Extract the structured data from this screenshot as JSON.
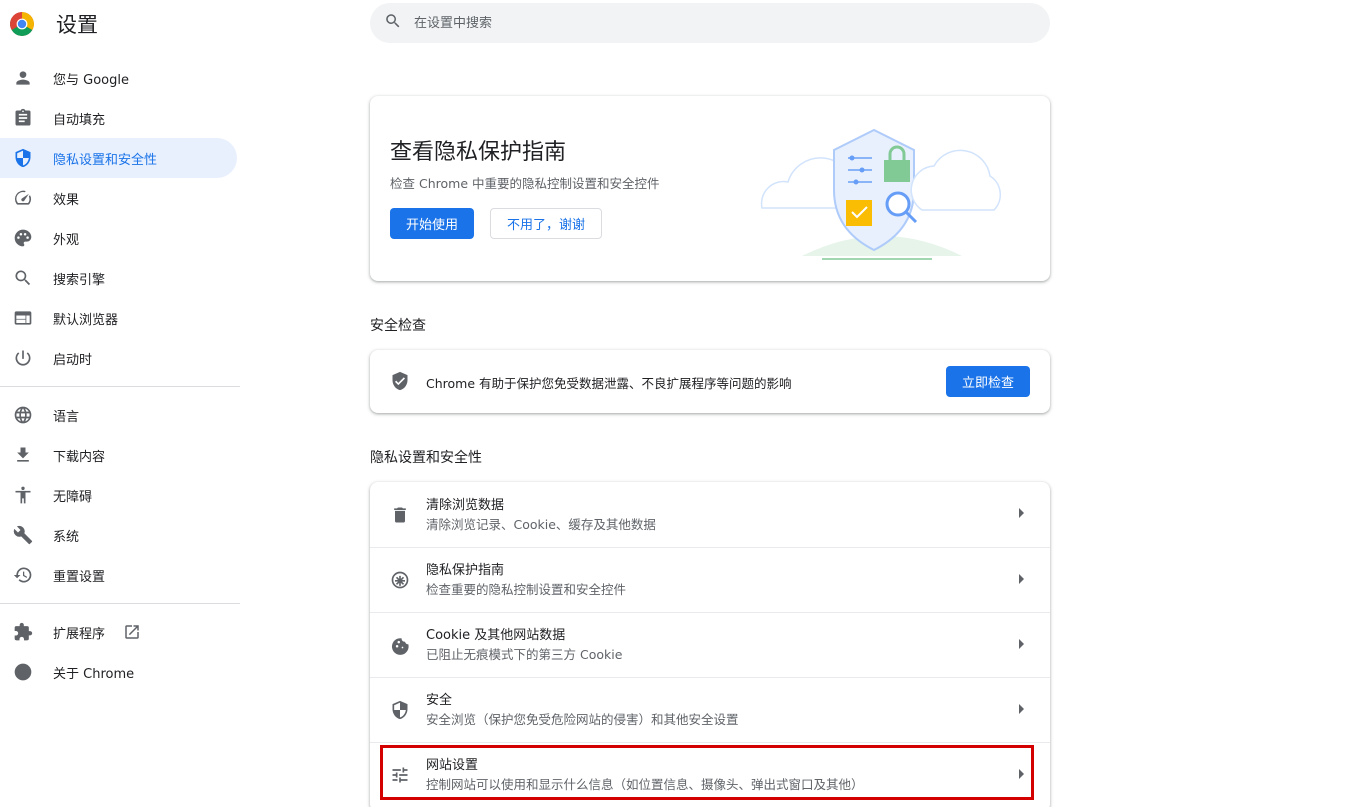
{
  "app": {
    "title": "设置"
  },
  "search": {
    "placeholder": "在设置中搜索"
  },
  "sidebar": {
    "items": [
      {
        "label": "您与 Google",
        "icon": "person-icon"
      },
      {
        "label": "自动填充",
        "icon": "clipboard-icon"
      },
      {
        "label": "隐私设置和安全性",
        "icon": "shield-icon",
        "active": true
      },
      {
        "label": "效果",
        "icon": "speedometer-icon"
      },
      {
        "label": "外观",
        "icon": "palette-icon"
      },
      {
        "label": "搜索引擎",
        "icon": "search-icon"
      },
      {
        "label": "默认浏览器",
        "icon": "browser-icon"
      },
      {
        "label": "启动时",
        "icon": "power-icon"
      }
    ],
    "items2": [
      {
        "label": "语言",
        "icon": "globe-icon"
      },
      {
        "label": "下载内容",
        "icon": "download-icon"
      },
      {
        "label": "无障碍",
        "icon": "accessibility-icon"
      },
      {
        "label": "系统",
        "icon": "wrench-icon"
      },
      {
        "label": "重置设置",
        "icon": "history-icon"
      }
    ],
    "items3": [
      {
        "label": "扩展程序",
        "icon": "puzzle-icon"
      },
      {
        "label": "关于 Chrome",
        "icon": "chrome-icon"
      }
    ]
  },
  "guide": {
    "title": "查看隐私保护指南",
    "description": "检查 Chrome 中重要的隐私控制设置和安全控件",
    "start_label": "开始使用",
    "no_label": "不用了，谢谢"
  },
  "safety": {
    "section_title": "安全检查",
    "text": "Chrome 有助于保护您免受数据泄露、不良扩展程序等问题的影响",
    "button_label": "立即检查"
  },
  "privacy": {
    "section_title": "隐私设置和安全性",
    "rows": [
      {
        "title": "清除浏览数据",
        "subtitle": "清除浏览记录、Cookie、缓存及其他数据",
        "icon": "trash-icon"
      },
      {
        "title": "隐私保护指南",
        "subtitle": "检查重要的隐私控制设置和安全控件",
        "icon": "compass-icon"
      },
      {
        "title": "Cookie 及其他网站数据",
        "subtitle": "已阻止无痕模式下的第三方 Cookie",
        "icon": "cookie-icon"
      },
      {
        "title": "安全",
        "subtitle": "安全浏览（保护您免受危险网站的侵害）和其他安全设置",
        "icon": "shield-half-icon"
      },
      {
        "title": "网站设置",
        "subtitle": "控制网站可以使用和显示什么信息（如位置信息、摄像头、弹出式窗口及其他）",
        "icon": "tune-icon"
      }
    ]
  },
  "colors": {
    "accent": "#1a73e8",
    "active_bg": "#e8f0fe",
    "highlight": "#d40000"
  }
}
